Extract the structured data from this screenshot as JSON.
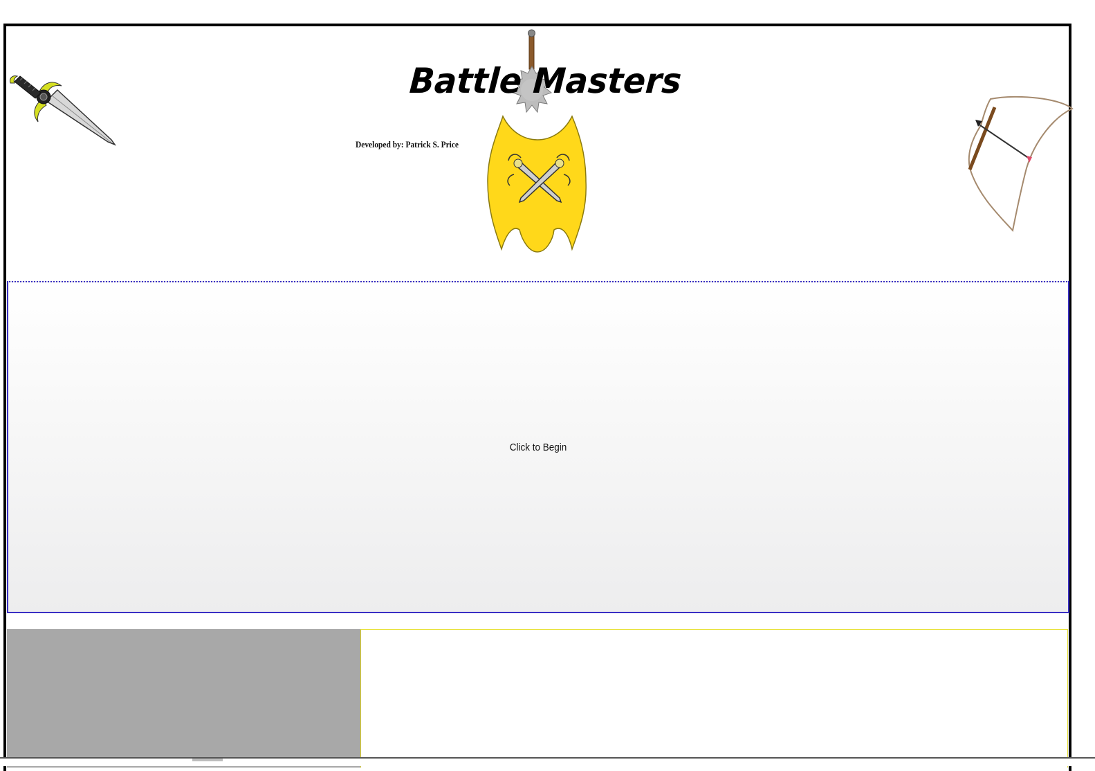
{
  "header": {
    "title": "Battle Masters",
    "credit": "Developed by: Patrick S. Price"
  },
  "start": {
    "label": "Click to Begin"
  },
  "colors": {
    "frame_border": "#000000",
    "panel_border": "#3a2fc4",
    "shield_fill": "#ffd81a",
    "bottom_left_fill": "#a8a8a8",
    "bottom_right_border": "#e8e23a"
  },
  "icons": {
    "sword": "sword-icon",
    "shield": "shield-crossed-swords-icon",
    "mace": "mace-icon",
    "bow": "bow-icon"
  }
}
